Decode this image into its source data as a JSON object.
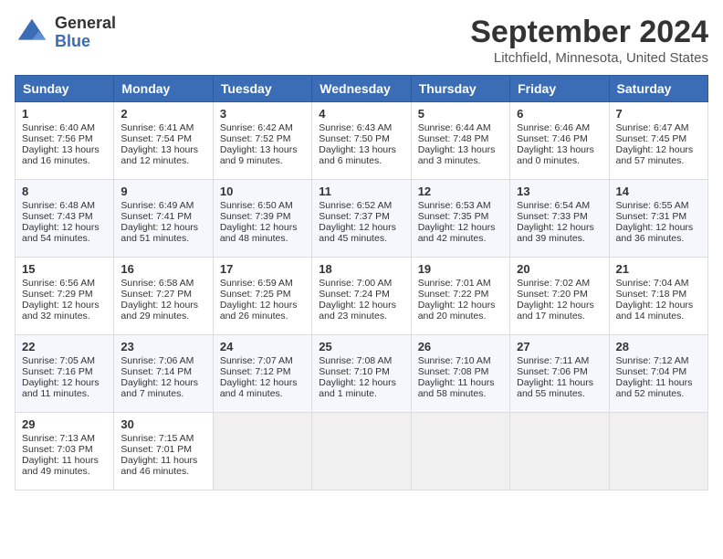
{
  "header": {
    "logo_line1": "General",
    "logo_line2": "Blue",
    "title": "September 2024",
    "subtitle": "Litchfield, Minnesota, United States"
  },
  "weekdays": [
    "Sunday",
    "Monday",
    "Tuesday",
    "Wednesday",
    "Thursday",
    "Friday",
    "Saturday"
  ],
  "weeks": [
    [
      {
        "day": "1",
        "lines": [
          "Sunrise: 6:40 AM",
          "Sunset: 7:56 PM",
          "Daylight: 13 hours",
          "and 16 minutes."
        ]
      },
      {
        "day": "2",
        "lines": [
          "Sunrise: 6:41 AM",
          "Sunset: 7:54 PM",
          "Daylight: 13 hours",
          "and 12 minutes."
        ]
      },
      {
        "day": "3",
        "lines": [
          "Sunrise: 6:42 AM",
          "Sunset: 7:52 PM",
          "Daylight: 13 hours",
          "and 9 minutes."
        ]
      },
      {
        "day": "4",
        "lines": [
          "Sunrise: 6:43 AM",
          "Sunset: 7:50 PM",
          "Daylight: 13 hours",
          "and 6 minutes."
        ]
      },
      {
        "day": "5",
        "lines": [
          "Sunrise: 6:44 AM",
          "Sunset: 7:48 PM",
          "Daylight: 13 hours",
          "and 3 minutes."
        ]
      },
      {
        "day": "6",
        "lines": [
          "Sunrise: 6:46 AM",
          "Sunset: 7:46 PM",
          "Daylight: 13 hours",
          "and 0 minutes."
        ]
      },
      {
        "day": "7",
        "lines": [
          "Sunrise: 6:47 AM",
          "Sunset: 7:45 PM",
          "Daylight: 12 hours",
          "and 57 minutes."
        ]
      }
    ],
    [
      {
        "day": "8",
        "lines": [
          "Sunrise: 6:48 AM",
          "Sunset: 7:43 PM",
          "Daylight: 12 hours",
          "and 54 minutes."
        ]
      },
      {
        "day": "9",
        "lines": [
          "Sunrise: 6:49 AM",
          "Sunset: 7:41 PM",
          "Daylight: 12 hours",
          "and 51 minutes."
        ]
      },
      {
        "day": "10",
        "lines": [
          "Sunrise: 6:50 AM",
          "Sunset: 7:39 PM",
          "Daylight: 12 hours",
          "and 48 minutes."
        ]
      },
      {
        "day": "11",
        "lines": [
          "Sunrise: 6:52 AM",
          "Sunset: 7:37 PM",
          "Daylight: 12 hours",
          "and 45 minutes."
        ]
      },
      {
        "day": "12",
        "lines": [
          "Sunrise: 6:53 AM",
          "Sunset: 7:35 PM",
          "Daylight: 12 hours",
          "and 42 minutes."
        ]
      },
      {
        "day": "13",
        "lines": [
          "Sunrise: 6:54 AM",
          "Sunset: 7:33 PM",
          "Daylight: 12 hours",
          "and 39 minutes."
        ]
      },
      {
        "day": "14",
        "lines": [
          "Sunrise: 6:55 AM",
          "Sunset: 7:31 PM",
          "Daylight: 12 hours",
          "and 36 minutes."
        ]
      }
    ],
    [
      {
        "day": "15",
        "lines": [
          "Sunrise: 6:56 AM",
          "Sunset: 7:29 PM",
          "Daylight: 12 hours",
          "and 32 minutes."
        ]
      },
      {
        "day": "16",
        "lines": [
          "Sunrise: 6:58 AM",
          "Sunset: 7:27 PM",
          "Daylight: 12 hours",
          "and 29 minutes."
        ]
      },
      {
        "day": "17",
        "lines": [
          "Sunrise: 6:59 AM",
          "Sunset: 7:25 PM",
          "Daylight: 12 hours",
          "and 26 minutes."
        ]
      },
      {
        "day": "18",
        "lines": [
          "Sunrise: 7:00 AM",
          "Sunset: 7:24 PM",
          "Daylight: 12 hours",
          "and 23 minutes."
        ]
      },
      {
        "day": "19",
        "lines": [
          "Sunrise: 7:01 AM",
          "Sunset: 7:22 PM",
          "Daylight: 12 hours",
          "and 20 minutes."
        ]
      },
      {
        "day": "20",
        "lines": [
          "Sunrise: 7:02 AM",
          "Sunset: 7:20 PM",
          "Daylight: 12 hours",
          "and 17 minutes."
        ]
      },
      {
        "day": "21",
        "lines": [
          "Sunrise: 7:04 AM",
          "Sunset: 7:18 PM",
          "Daylight: 12 hours",
          "and 14 minutes."
        ]
      }
    ],
    [
      {
        "day": "22",
        "lines": [
          "Sunrise: 7:05 AM",
          "Sunset: 7:16 PM",
          "Daylight: 12 hours",
          "and 11 minutes."
        ]
      },
      {
        "day": "23",
        "lines": [
          "Sunrise: 7:06 AM",
          "Sunset: 7:14 PM",
          "Daylight: 12 hours",
          "and 7 minutes."
        ]
      },
      {
        "day": "24",
        "lines": [
          "Sunrise: 7:07 AM",
          "Sunset: 7:12 PM",
          "Daylight: 12 hours",
          "and 4 minutes."
        ]
      },
      {
        "day": "25",
        "lines": [
          "Sunrise: 7:08 AM",
          "Sunset: 7:10 PM",
          "Daylight: 12 hours",
          "and 1 minute."
        ]
      },
      {
        "day": "26",
        "lines": [
          "Sunrise: 7:10 AM",
          "Sunset: 7:08 PM",
          "Daylight: 11 hours",
          "and 58 minutes."
        ]
      },
      {
        "day": "27",
        "lines": [
          "Sunrise: 7:11 AM",
          "Sunset: 7:06 PM",
          "Daylight: 11 hours",
          "and 55 minutes."
        ]
      },
      {
        "day": "28",
        "lines": [
          "Sunrise: 7:12 AM",
          "Sunset: 7:04 PM",
          "Daylight: 11 hours",
          "and 52 minutes."
        ]
      }
    ],
    [
      {
        "day": "29",
        "lines": [
          "Sunrise: 7:13 AM",
          "Sunset: 7:03 PM",
          "Daylight: 11 hours",
          "and 49 minutes."
        ]
      },
      {
        "day": "30",
        "lines": [
          "Sunrise: 7:15 AM",
          "Sunset: 7:01 PM",
          "Daylight: 11 hours",
          "and 46 minutes."
        ]
      },
      null,
      null,
      null,
      null,
      null
    ]
  ]
}
